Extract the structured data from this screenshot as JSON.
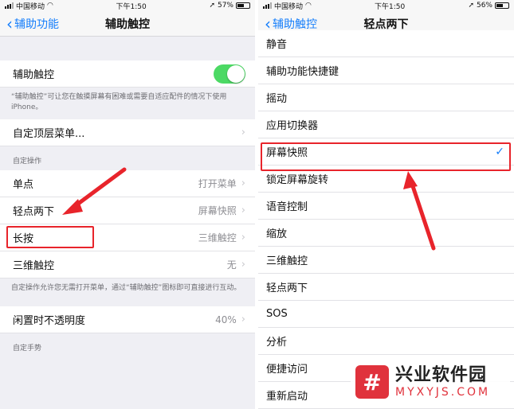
{
  "left": {
    "status": {
      "carrier": "中国移动",
      "time": "下午1:50",
      "battery": "57%",
      "battery_level": 0.57
    },
    "nav": {
      "back_label": "辅助功能",
      "title": "辅助触控"
    },
    "assistive_touch": {
      "label": "辅助触控",
      "enabled": true
    },
    "assistive_note": "“辅助触控”可让您在触摸屏幕有困难或需要自适应配件的情况下使用 iPhone。",
    "custom_top_menu": "自定顶层菜单...",
    "custom_actions_header": "自定操作",
    "actions": [
      {
        "label": "单点",
        "value": "打开菜单"
      },
      {
        "label": "轻点两下",
        "value": "屏幕快照"
      },
      {
        "label": "长按",
        "value": "三维触控"
      },
      {
        "label": "三维触控",
        "value": "无"
      }
    ],
    "actions_note": "自定操作允许您无需打开菜单，通过“辅助触控”图标即可直接进行互动。",
    "idle_opacity": {
      "label": "闲置时不透明度",
      "value": "40%"
    },
    "custom_gestures_header": "自定手势"
  },
  "right": {
    "status": {
      "carrier": "中国移动",
      "time": "下午1:50",
      "battery": "56%",
      "battery_level": 0.56
    },
    "nav": {
      "back_label": "辅助触控",
      "title": "轻点两下"
    },
    "options": [
      {
        "label": "静音",
        "selected": false
      },
      {
        "label": "辅助功能快捷键",
        "selected": false
      },
      {
        "label": "摇动",
        "selected": false
      },
      {
        "label": "应用切换器",
        "selected": false
      },
      {
        "label": "屏幕快照",
        "selected": true
      },
      {
        "label": "锁定屏幕旋转",
        "selected": false
      },
      {
        "label": "语音控制",
        "selected": false
      },
      {
        "label": "缩放",
        "selected": false
      },
      {
        "label": "三维触控",
        "selected": false
      },
      {
        "label": "轻点两下",
        "selected": false
      },
      {
        "label": "SOS",
        "selected": false
      },
      {
        "label": "分析",
        "selected": false
      },
      {
        "label": "便捷访问",
        "selected": false
      },
      {
        "label": "重新启动",
        "selected": false
      }
    ],
    "check_glyph": "✓"
  },
  "watermark": {
    "logo_glyph": "#",
    "name": "兴业软件园",
    "domain": "MYXYJS.COM"
  },
  "colors": {
    "accent": "#157efb",
    "toggle_on": "#4cd964",
    "highlight": "#e8242b"
  }
}
